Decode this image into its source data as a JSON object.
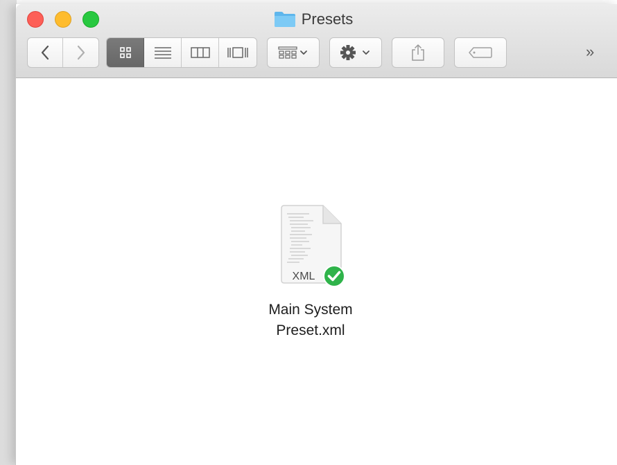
{
  "window": {
    "title": "Presets"
  },
  "toolbar": {
    "overflow_label": "»",
    "buttons": [
      {
        "name": "back",
        "icon": "chevron-left-icon"
      },
      {
        "name": "forward",
        "icon": "chevron-right-icon"
      },
      {
        "name": "icon-view",
        "icon": "grid-icon",
        "active": true
      },
      {
        "name": "list-view",
        "icon": "list-icon"
      },
      {
        "name": "column-view",
        "icon": "columns-icon"
      },
      {
        "name": "gallery-view",
        "icon": "gallery-icon"
      },
      {
        "name": "arrange",
        "icon": "arrange-icon"
      },
      {
        "name": "action",
        "icon": "gear-icon"
      },
      {
        "name": "share",
        "icon": "share-icon"
      },
      {
        "name": "tags",
        "icon": "tag-icon"
      }
    ]
  },
  "files": [
    {
      "name": "Main System\nPreset.xml",
      "type_label": "XML",
      "status": "synced"
    }
  ],
  "colors": {
    "close": "#fd5f57",
    "minimize": "#febc2e",
    "maximize": "#28c840",
    "folder": "#6fc1f1",
    "check_badge": "#2fb34a",
    "active_segment": "#6e6e6e"
  }
}
